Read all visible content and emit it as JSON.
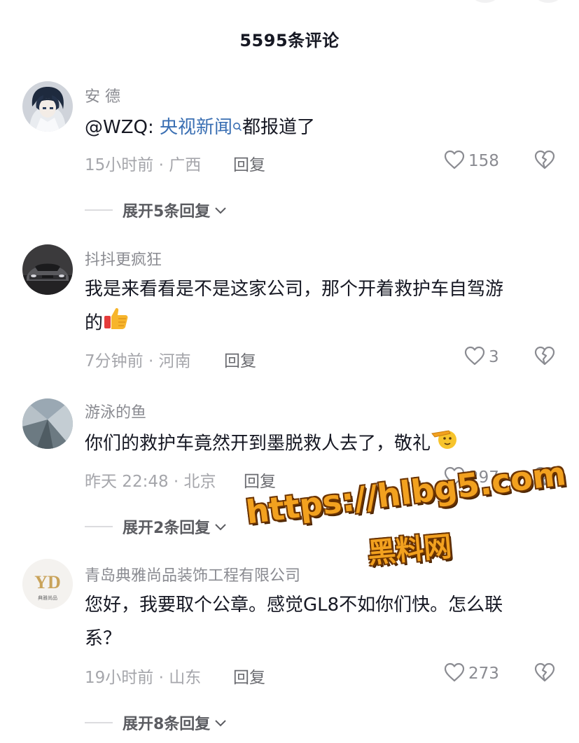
{
  "header": {
    "title": "5595条评论"
  },
  "comments": [
    {
      "username": "安 德",
      "mention": "@WZQ: ",
      "search_link": "央视新闻",
      "text_after": "都报道了",
      "time_location": "15小时前 · 广西",
      "reply_label": "回复",
      "like_count": "158",
      "expand_label": "展开5条回复"
    },
    {
      "username": "抖抖更疯狂",
      "text_line1": "我是来看看是不是这家公司，那个开着救护车自驾游",
      "text_line2": "的",
      "time_location": "7分钟前 · 河南",
      "reply_label": "回复",
      "like_count": "3"
    },
    {
      "username": "游泳的鱼",
      "text_line1": "你们的救护车竟然开到墨脱救人去了，敬礼",
      "time_location": "昨天 22:48 · 北京",
      "reply_label": "回复",
      "like_count": "297",
      "expand_label": "展开2条回复"
    },
    {
      "username": "青岛典雅尚品装饰工程有限公司",
      "avatar_letters": "YD",
      "avatar_caption": "典雅尚品",
      "text_line1": "您好，我要取个公章。感觉GL8不如你们快。怎么联",
      "text_line2": "系？",
      "time_location": "19小时前 · 山东",
      "reply_label": "回复",
      "like_count": "273",
      "expand_label": "展开8条回复"
    }
  ],
  "watermark": {
    "url": "https://hlbg5.com",
    "text": "黑料网"
  },
  "colors": {
    "link": "#3a6fb3",
    "watermark": "#f2a11f",
    "muted": "#a5a6ab"
  },
  "icons": [
    "search-icon",
    "heart-outline-icon",
    "broken-heart-icon",
    "chevron-down-icon",
    "thumbs-up-emoji",
    "salute-emoji"
  ]
}
